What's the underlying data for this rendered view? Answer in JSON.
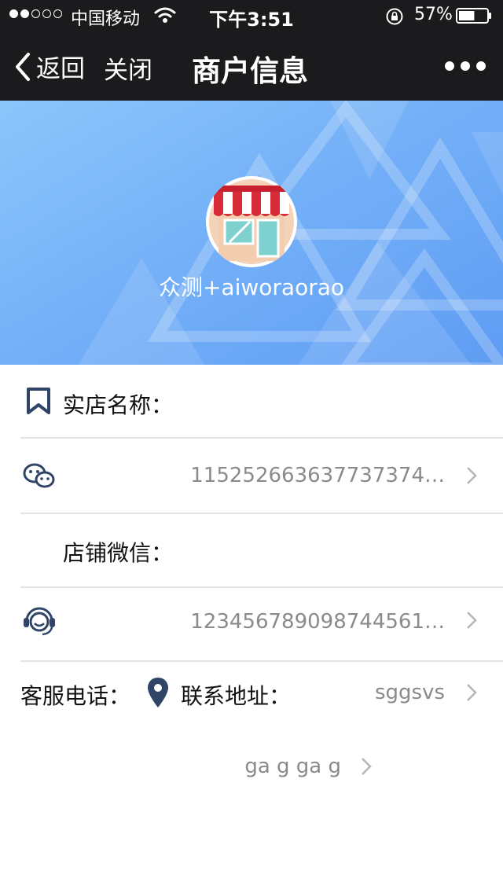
{
  "status_bar": {
    "carrier": "中国移动",
    "time": "下午3:51",
    "battery": "57%",
    "battery_level": 0.57
  },
  "nav": {
    "back_label": "返回",
    "close_label": "关闭",
    "title": "商户信息"
  },
  "profile": {
    "shop_name": "众测+aiworaorao"
  },
  "info": {
    "store_name_label": "实店名称：",
    "wechat_value": "115252663637737374…",
    "shop_wechat_label": "店铺微信：",
    "phone_value": "12345678909874456​1…",
    "service_phone_label": "客服电话：",
    "address_label": "联系地址：",
    "address_value": "sggsvs",
    "extra_value": "ga g ga g"
  },
  "colors": {
    "bar": "#1b1b1d",
    "banner_light": "#8cc6fb",
    "banner_dark": "#5e9cf3",
    "icon_navy": "#2f4466",
    "value_gray": "#8a8a8a"
  }
}
